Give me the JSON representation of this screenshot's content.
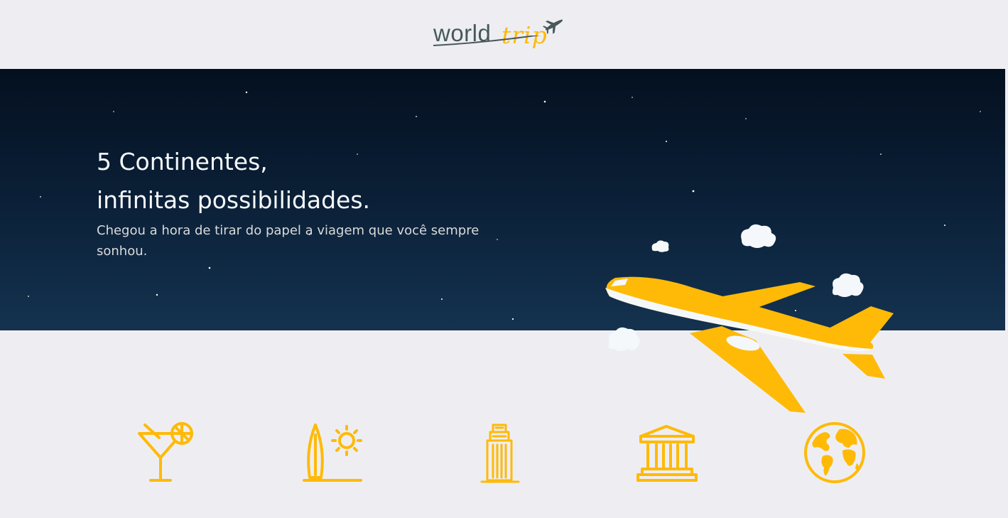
{
  "header": {
    "logo_part_1": "world",
    "logo_part_2": "trip",
    "logo_alt": "worldtrip"
  },
  "banner": {
    "title_line_1": "5 Continentes,",
    "title_line_2": "infinitas possibilidades.",
    "subtitle": "Chegou a hora de tirar do papel a viagem que você sempre sonhou."
  },
  "travel_types": [
    {
      "icon": "cocktail-icon"
    },
    {
      "icon": "surf-icon"
    },
    {
      "icon": "building-icon"
    },
    {
      "icon": "museum-icon"
    },
    {
      "icon": "earth-icon"
    }
  ],
  "colors": {
    "accent": "#FFBA08",
    "dark_text": "#47585B",
    "light_text": "#F5F8FA",
    "background": "#EEEEF2",
    "banner_dark": "#04101F"
  }
}
